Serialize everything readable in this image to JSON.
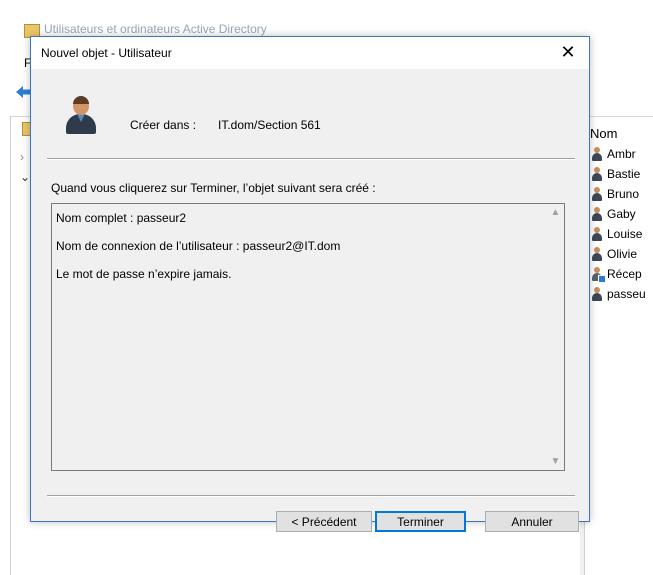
{
  "background_window": {
    "title": "Utilisateurs et ordinateurs Active Directory",
    "menu_letter": "F",
    "list_header": "Nom",
    "list_items": [
      {
        "name": "Ambr",
        "type": "user"
      },
      {
        "name": "Bastie",
        "type": "user"
      },
      {
        "name": "Bruno",
        "type": "user"
      },
      {
        "name": "Gaby",
        "type": "user"
      },
      {
        "name": "Louise",
        "type": "user"
      },
      {
        "name": "Olivie",
        "type": "user"
      },
      {
        "name": "Récep",
        "type": "contact"
      },
      {
        "name": "passeu",
        "type": "user"
      }
    ]
  },
  "dialog": {
    "title": "Nouvel objet - Utilisateur",
    "close_glyph": "✕",
    "create_in_label": "Créer dans :",
    "create_in_path": "IT.dom/Section 561",
    "summary_intro": "Quand vous cliquerez sur Terminer, l’objet suivant sera créé :",
    "summary_lines": [
      "Nom complet : passeur2",
      "Nom de connexion de l’utilisateur : passeur2@IT.dom",
      "Le mot de passe n’expire jamais."
    ],
    "buttons": {
      "previous": "< Précédent",
      "finish": "Terminer",
      "cancel": "Annuler"
    }
  },
  "colors": {
    "dialog_border": "#3a75c4",
    "default_button_border": "#0078d7",
    "dialog_background": "#f0f0f0"
  }
}
